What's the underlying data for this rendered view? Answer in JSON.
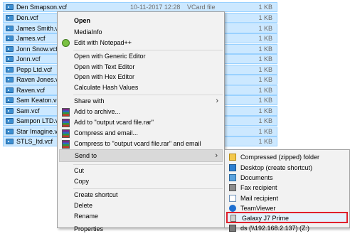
{
  "files": [
    {
      "name": "Den Smapson.vcf",
      "date": "10-11-2017 12:28",
      "type": "VCard file",
      "size": "1 KB"
    },
    {
      "name": "Den.vcf",
      "size": "1 KB"
    },
    {
      "name": "James Smith.vcf",
      "size": "1 KB"
    },
    {
      "name": "James.vcf",
      "size": "1 KB"
    },
    {
      "name": "Jonn Snow.vcf",
      "size": "1 KB"
    },
    {
      "name": "Jonn.vcf",
      "size": "1 KB"
    },
    {
      "name": "Pepp Ltd.vcf",
      "size": "1 KB"
    },
    {
      "name": "Raven Jones.vcf",
      "size": "1 KB"
    },
    {
      "name": "Raven.vcf",
      "size": "1 KB"
    },
    {
      "name": "Sam Keaton.vcf",
      "size": "1 KB"
    },
    {
      "name": "Sam.vcf",
      "size": "1 KB"
    },
    {
      "name": "Sampon LTD.vcf",
      "size": "1 KB"
    },
    {
      "name": "Star Imagine.vcf",
      "size": "1 KB"
    },
    {
      "name": "STLS_ltd.vcf",
      "size": "1 KB"
    }
  ],
  "context_menu": {
    "open": "Open",
    "mediainfo": "MediaInfo",
    "edit_notepad": "Edit with Notepad++",
    "open_generic": "Open with Generic Editor",
    "open_text": "Open with Text Editor",
    "open_hex": "Open with Hex Editor",
    "calc_hash": "Calculate Hash Values",
    "share_with": "Share with",
    "add_archive": "Add to archive...",
    "add_rar": "Add to \"output vcard file.rar\"",
    "compress_email": "Compress and email...",
    "compress_rar_email": "Compress to \"output vcard file.rar\" and email",
    "send_to": "Send to",
    "cut": "Cut",
    "copy": "Copy",
    "create_shortcut": "Create shortcut",
    "delete": "Delete",
    "rename": "Rename",
    "properties": "Properties"
  },
  "send_to_menu": {
    "compressed": "Compressed (zipped) folder",
    "desktop": "Desktop (create shortcut)",
    "documents": "Documents",
    "fax": "Fax recipient",
    "mail": "Mail recipient",
    "teamviewer": "TeamViewer",
    "galaxy": "Galaxy J7 Prime",
    "network": "ds (\\\\192.168.2.137) (Z:)"
  },
  "icons": {
    "vcf": "vcard-file-icon",
    "rar": "winrar-icon",
    "notepad": "notepad-plus-plus-icon",
    "submenu_arrow": "chevron-right-icon"
  },
  "colors": {
    "selection": "#cce8ff",
    "selection_border": "#99d1ff",
    "menu_bg": "#f2f2f2",
    "highlight_box": "#e0202b"
  }
}
